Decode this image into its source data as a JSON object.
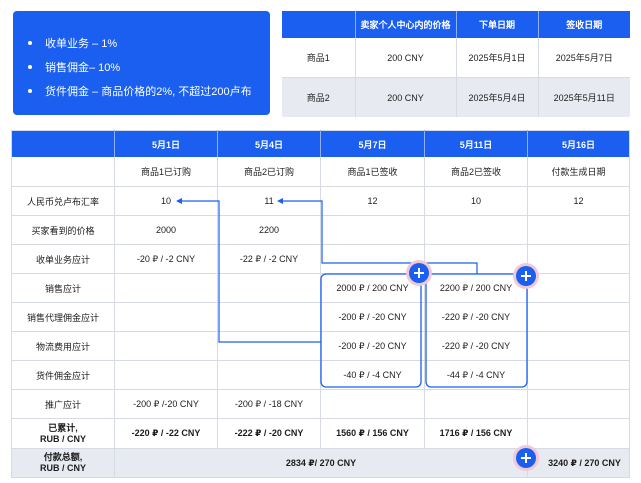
{
  "summary": {
    "items": [
      "收单业务 – 1%",
      "销售佣金– 10%",
      "货件佣金 – 商品价格的2%, 不超过200卢布"
    ]
  },
  "products_table": {
    "headers": [
      "",
      "卖家个人中心内的价格",
      "下单日期",
      "签收日期"
    ],
    "rows": [
      [
        "商品1",
        "200 CNY",
        "2025年5月1日",
        "2025年5月7日"
      ],
      [
        "商品2",
        "200 CNY",
        "2025年5月4日",
        "2025年5月11日"
      ]
    ]
  },
  "timeline_table": {
    "headers": [
      "",
      "5月1日",
      "5月4日",
      "5月7日",
      "5月11日",
      "5月16日"
    ],
    "event_row": [
      "",
      "商品1已订购",
      "商品2已订购",
      "商品1已签收",
      "商品2已签收",
      "付款生成日期"
    ],
    "rows": [
      [
        "人民币兑卢布汇率",
        "10",
        "11",
        "12",
        "10",
        "12"
      ],
      [
        "买家看到的价格",
        "2000",
        "2200",
        "",
        "",
        ""
      ],
      [
        "收单业务应计",
        "-20 ₽ / -2 CNY",
        "-22 ₽ / -2 CNY",
        "",
        "",
        ""
      ],
      [
        "销售应计",
        "",
        "",
        "2000 ₽ / 200 CNY",
        "2200 ₽ / 200 CNY",
        ""
      ],
      [
        "销售代理佣金应计",
        "",
        "",
        "-200 ₽ / -20 CNY",
        "-220 ₽ / -20 CNY",
        ""
      ],
      [
        "物流费用应计",
        "",
        "",
        "-200 ₽ / -20 CNY",
        "-220 ₽ / -20 CNY",
        ""
      ],
      [
        "货件佣金应计",
        "",
        "",
        "-40 ₽ / -4 CNY",
        "-44 ₽ / -4 CNY",
        ""
      ],
      [
        "推广应计",
        "-200 ₽ /-20 CNY",
        "-200 ₽ / -18 CNY",
        "",
        "",
        ""
      ]
    ],
    "total_row": {
      "label_line1": "已累计,",
      "label_line2": "RUB / CNY",
      "values": [
        "-220 ₽ / -22 CNY",
        "-222 ₽ / -20 CNY",
        "1560 ₽ / 156 CNY",
        "1716 ₽ / 156 CNY",
        ""
      ]
    },
    "payment_row": {
      "label_line1": "付款总额,",
      "label_line2": "RUB / CNY",
      "merged_value": "2834 ₽/ 270 CNY",
      "final_value": "3240 ₽ / 270 CNY"
    }
  },
  "colors": {
    "accent": "#1a5ff0",
    "row_alt": "#e7eaf0",
    "plus_ring": "#f4c7d6"
  },
  "icons": [
    "plus-circle-icon",
    "arrow-left-icon"
  ]
}
